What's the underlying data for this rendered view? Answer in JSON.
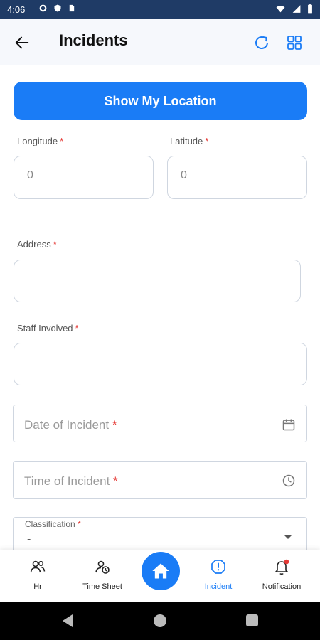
{
  "status_bar": {
    "time": "4:06",
    "left_icons": [
      "gear-icon",
      "shield-icon",
      "sim-card-icon"
    ],
    "right_icons": [
      "wifi-icon",
      "signal-icon",
      "battery-icon"
    ]
  },
  "header": {
    "title": "Incidents",
    "back_icon": "arrow-left-icon",
    "actions": [
      "refresh-icon",
      "grid-view-icon"
    ]
  },
  "location_button": {
    "label": "Show My Location"
  },
  "form": {
    "longitude": {
      "label": "Longitude",
      "required": "*",
      "value": "0"
    },
    "latitude": {
      "label": "Latitude",
      "required": "*",
      "value": "0"
    },
    "address": {
      "label": "Address",
      "required": "*",
      "value": ""
    },
    "staff_involved": {
      "label": "Staff Involved",
      "required": "*",
      "value": ""
    },
    "date_of_incident": {
      "placeholder": "Date of Incident",
      "required": "*"
    },
    "time_of_incident": {
      "placeholder": "Time of Incident",
      "required": "*"
    },
    "classification": {
      "label": "Classification",
      "required": "*",
      "value": "-"
    }
  },
  "bottom_nav": {
    "items": [
      {
        "label": "Hr",
        "icon": "people-icon"
      },
      {
        "label": "Time Sheet",
        "icon": "timesheet-icon"
      },
      {
        "label": "",
        "icon": "home-icon"
      },
      {
        "label": "Incident",
        "icon": "alert-icon",
        "active": true
      },
      {
        "label": "Notification",
        "icon": "bell-icon"
      }
    ]
  },
  "colors": {
    "primary": "#1a7cf6",
    "status_bar": "#1f3b66",
    "required": "#e53935"
  }
}
